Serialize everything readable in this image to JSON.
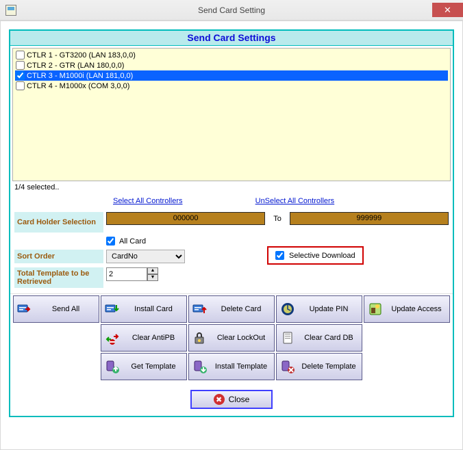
{
  "window": {
    "title": "Send Card Setting",
    "close_x": "✕"
  },
  "banner": "Send Card Settings",
  "controllers": [
    {
      "label": "CTLR 1 - GT3200 (LAN 183,0,0)",
      "checked": false,
      "selected": false
    },
    {
      "label": "CTLR 2 - GTR (LAN 180,0,0)",
      "checked": false,
      "selected": false
    },
    {
      "label": "CTLR 3 - M1000i (LAN 181,0,0)",
      "checked": true,
      "selected": true
    },
    {
      "label": "CTLR 4 - M1000x (COM 3,0,0)",
      "checked": false,
      "selected": false
    }
  ],
  "status": "1/4 selected..",
  "links": {
    "select_all": "Select All Controllers",
    "unselect_all": "UnSelect All Controllers"
  },
  "card_holder": {
    "label": "Card Holder Selection",
    "from": "000000",
    "to_label": "To",
    "to": "999999",
    "all_card_label": "All Card",
    "all_card_checked": true
  },
  "sort_order": {
    "label": "Sort Order",
    "value": "CardNo"
  },
  "template_total": {
    "label": "Total Template to be Retrieved",
    "value": "2"
  },
  "selective_download": {
    "label": "Selective Download",
    "checked": true
  },
  "buttons": {
    "row1": [
      {
        "name": "send-all-button",
        "label": "Send All",
        "icon": "send-all-icon"
      },
      {
        "name": "install-card-button",
        "label": "Install Card",
        "icon": "install-card-icon"
      },
      {
        "name": "delete-card-button",
        "label": "Delete Card",
        "icon": "delete-card-icon"
      },
      {
        "name": "update-pin-button",
        "label": "Update PIN",
        "icon": "update-pin-icon"
      },
      {
        "name": "update-access-button",
        "label": "Update Access",
        "icon": "update-access-icon"
      }
    ],
    "row2": [
      {
        "name": "clear-antipb-button",
        "label": "Clear AntiPB",
        "icon": "clear-antipb-icon"
      },
      {
        "name": "clear-lockout-button",
        "label": "Clear LockOut",
        "icon": "clear-lockout-icon"
      },
      {
        "name": "clear-carddb-button",
        "label": "Clear Card DB",
        "icon": "clear-carddb-icon"
      }
    ],
    "row3": [
      {
        "name": "get-template-button",
        "label": "Get Template",
        "icon": "get-template-icon"
      },
      {
        "name": "install-template-button",
        "label": "Install Template",
        "icon": "install-template-icon"
      },
      {
        "name": "delete-template-button",
        "label": "Delete Template",
        "icon": "delete-template-icon"
      }
    ],
    "close": "Close"
  }
}
